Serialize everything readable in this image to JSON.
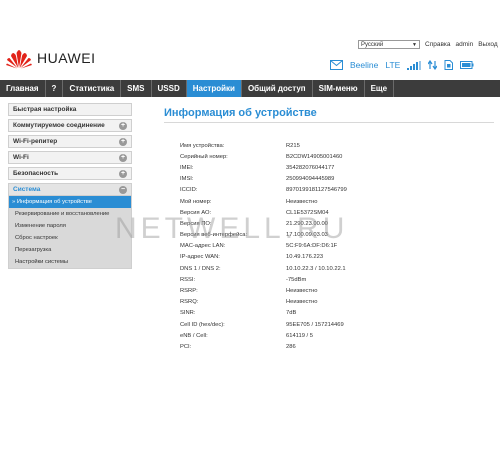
{
  "topbar": {
    "language": "Русский",
    "help": "Справка",
    "user": "admin",
    "logout": "Выход"
  },
  "brand": {
    "name": "HUAWEI",
    "color": "#e2231a"
  },
  "status": {
    "carrier": "Beeline",
    "network": "LTE"
  },
  "nav": [
    {
      "label": "Главная"
    },
    {
      "label": "?"
    },
    {
      "label": "Статистика"
    },
    {
      "label": "SMS"
    },
    {
      "label": "USSD"
    },
    {
      "label": "Настройки"
    },
    {
      "label": "Общий доступ"
    },
    {
      "label": "SIM-меню"
    },
    {
      "label": "Еще"
    }
  ],
  "sidebar": {
    "sections": [
      {
        "label": "Быстрая настройка"
      },
      {
        "label": "Коммутируемое соединение"
      },
      {
        "label": "Wi-Fi-репитер"
      },
      {
        "label": "Wi-Fi"
      },
      {
        "label": "Безопасность"
      },
      {
        "label": "Система"
      }
    ],
    "system_items": [
      {
        "label": "» Информация об устройстве"
      },
      {
        "label": "Резервирование и восстановление"
      },
      {
        "label": "Изменение пароля"
      },
      {
        "label": "Сброс настроек"
      },
      {
        "label": "Перезагрузка"
      },
      {
        "label": "Настройки системы"
      }
    ]
  },
  "main": {
    "title": "Информация об устройстве",
    "rows": [
      {
        "key": "Имя устройства:",
        "value": "R215"
      },
      {
        "key": "Серийный номер:",
        "value": "B2CDW14905001460"
      },
      {
        "key": "IMEI:",
        "value": "354282076044177"
      },
      {
        "key": "IMSI:",
        "value": "250994094445989"
      },
      {
        "key": "ICCID:",
        "value": "8970199181127546799"
      },
      {
        "key": "Мой номер:",
        "value": "Неизвестно"
      },
      {
        "key": "Версия АО:",
        "value": "CL1E5372SM04"
      },
      {
        "key": "Версия ПО:",
        "value": "21.290.23.00.00"
      },
      {
        "key": "Версия веб-интерфейса:",
        "value": "17.100.09.03.03"
      },
      {
        "key": "MAC-адрес LAN:",
        "value": "5C:F9:6A:DF:D6:1F"
      },
      {
        "key": "IP-адрес WAN:",
        "value": "10.49.176.223"
      },
      {
        "key": "DNS 1 / DNS 2:",
        "value": "10.10.22.3 / 10.10.22.1"
      },
      {
        "key": "RSSI:",
        "value": "-75dBm"
      },
      {
        "key": "RSRP:",
        "value": "Неизвестно"
      },
      {
        "key": "RSRQ:",
        "value": "Неизвестно"
      },
      {
        "key": "SINR:",
        "value": "7dB"
      },
      {
        "key": "Cell ID (hex/dec):",
        "value": "95EE705 / 157214469"
      },
      {
        "key": "eNB / Cell:",
        "value": "614119 / 5"
      },
      {
        "key": "PCI:",
        "value": "286"
      }
    ]
  },
  "watermark": "NETWELL.RU",
  "colors": {
    "accent": "#2a8dd4",
    "nav_bg": "#3c3c3c",
    "brand": "#e2231a"
  }
}
